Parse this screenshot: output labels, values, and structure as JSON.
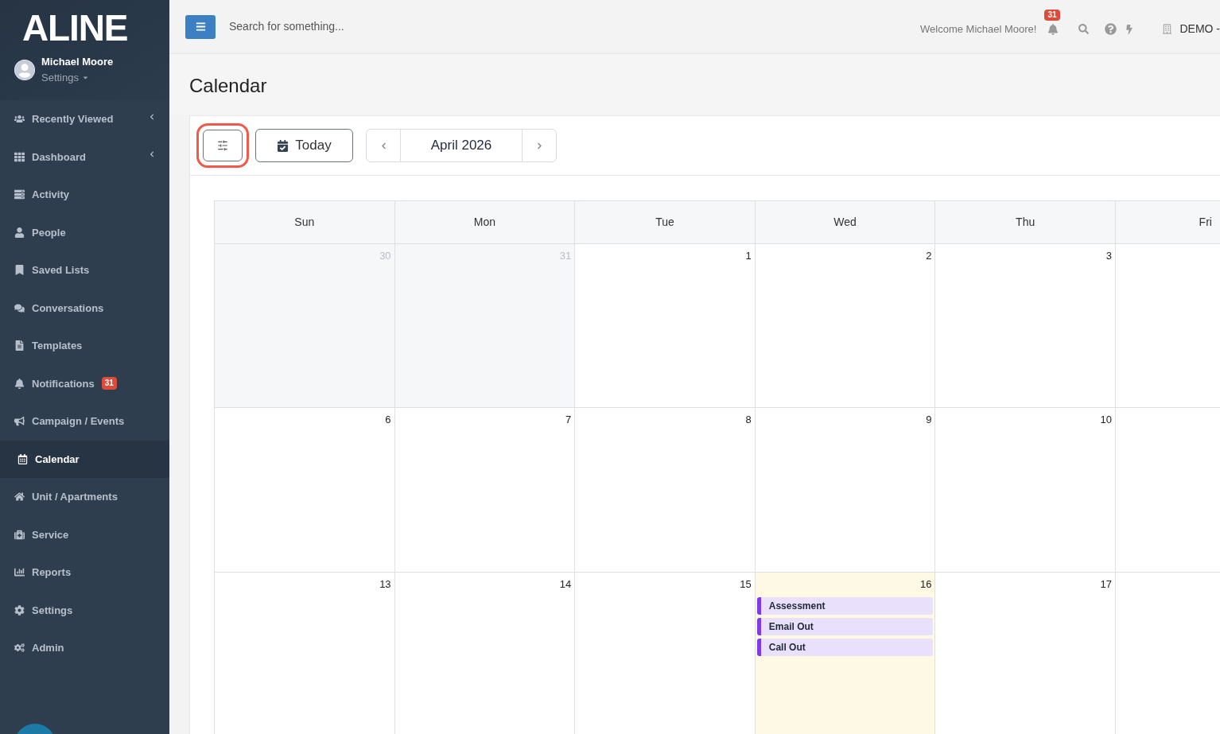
{
  "sidebar": {
    "logo": "ALINE",
    "user": {
      "name": "Michael Moore",
      "menu": "Settings"
    },
    "items": [
      {
        "kind": "users",
        "label": "Recently Viewed",
        "expandable": true,
        "selected": false
      },
      {
        "kind": "grid",
        "label": "Dashboard",
        "expandable": true,
        "selected": false
      },
      {
        "kind": "list",
        "label": "Activity",
        "expandable": false,
        "selected": false
      },
      {
        "kind": "user",
        "label": "People",
        "expandable": false,
        "selected": false
      },
      {
        "kind": "bookmark",
        "label": "Saved Lists",
        "expandable": false,
        "selected": false
      },
      {
        "kind": "comments",
        "label": "Conversations",
        "expandable": false,
        "selected": false
      },
      {
        "kind": "file",
        "label": "Templates",
        "expandable": false,
        "selected": false
      },
      {
        "kind": "bell",
        "label": "Notifications",
        "badge": "31",
        "expandable": false,
        "selected": false
      },
      {
        "kind": "bullhorn",
        "label": "Campaign / Events",
        "expandable": false,
        "selected": false
      },
      {
        "kind": "calendar",
        "label": "Calendar",
        "expandable": false,
        "selected": true
      },
      {
        "kind": "home",
        "label": "Unit / Apartments",
        "expandable": false,
        "selected": false
      },
      {
        "kind": "medkit",
        "label": "Service",
        "expandable": false,
        "selected": false
      },
      {
        "kind": "chart",
        "label": "Reports",
        "expandable": false,
        "selected": false
      },
      {
        "kind": "cog",
        "label": "Settings",
        "expandable": false,
        "selected": false
      },
      {
        "kind": "cogs",
        "label": "Admin",
        "expandable": false,
        "selected": false
      }
    ]
  },
  "topbar": {
    "search": {
      "placeholder": "Search for something..."
    },
    "welcome": "Welcome Michael Moore!",
    "notification_count": "31",
    "account": "DEMO -"
  },
  "page": {
    "title": "Calendar"
  },
  "toolbar": {
    "today": "Today",
    "month": "April 2026"
  },
  "calendar": {
    "days": [
      "Sun",
      "Mon",
      "Tue",
      "Wed",
      "Thu",
      "Fri"
    ],
    "weeks": [
      [
        {
          "date": "30",
          "outside": true,
          "today": false
        },
        {
          "date": "31",
          "outside": true,
          "today": false
        },
        {
          "date": "1",
          "outside": false,
          "today": false
        },
        {
          "date": "2",
          "outside": false,
          "today": false
        },
        {
          "date": "3",
          "outside": false,
          "today": false
        }
      ],
      [
        {
          "date": "6",
          "outside": false,
          "today": false
        },
        {
          "date": "7",
          "outside": false,
          "today": false
        },
        {
          "date": "8",
          "outside": false,
          "today": false
        },
        {
          "date": "9",
          "outside": false,
          "today": false
        },
        {
          "date": "10",
          "outside": false,
          "today": false
        }
      ],
      [
        {
          "date": "13",
          "outside": false,
          "today": false
        },
        {
          "date": "14",
          "outside": false,
          "today": false
        },
        {
          "date": "15",
          "outside": false,
          "today": false
        },
        {
          "date": "16",
          "outside": false,
          "today": true,
          "events": [
            {
              "title": "Assessment",
              "color": "#7c3aed"
            },
            {
              "title": "Email Out",
              "color": "#7c3aed"
            },
            {
              "title": "Call Out",
              "color": "#7c3aed"
            }
          ]
        },
        {
          "date": "17",
          "outside": false,
          "today": false
        }
      ]
    ]
  }
}
